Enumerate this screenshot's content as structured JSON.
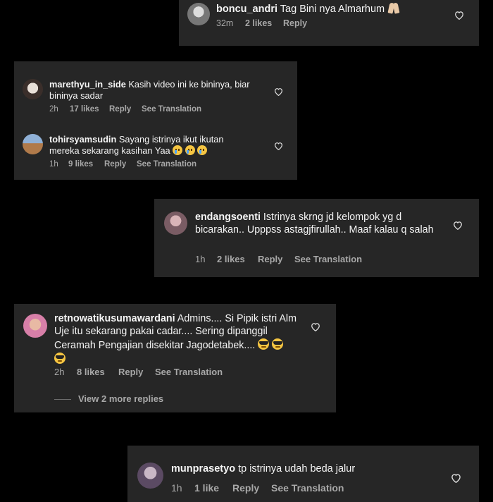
{
  "comments": [
    {
      "username": "boncu_andri",
      "text": "Tag Bini nya Almarhum",
      "emoji_trailing": "folded-hands",
      "time": "32m",
      "likes": "2 likes",
      "reply": "Reply"
    },
    {
      "username": "marethyu_in_side",
      "text": "Kasih video ini ke bininya, biar bininya sadar",
      "time": "2h",
      "likes": "17 likes",
      "reply": "Reply",
      "translate": "See Translation"
    },
    {
      "username": "tohirsyamsudin",
      "text": "Sayang istrinya ikut ikutan mereka sekarang kasihan Yaa",
      "emoji_trailing": "crying-face x3",
      "time": "1h",
      "likes": "9 likes",
      "reply": "Reply",
      "translate": "See Translation"
    },
    {
      "username": "endangsoenti",
      "text": "Istrinya skrng jd kelompok yg d bicarakan.. Upppss astagjfirullah.. Maaf kalau q salah",
      "time": "1h",
      "likes": "2 likes",
      "reply": "Reply",
      "translate": "See Translation"
    },
    {
      "username": "retnowatikusumawardani",
      "text": "Admins.... Si Pipik istri Alm Uje itu sekarang pakai cadar.... Sering dipanggil Ceramah Pengajian disekitar Jagodetabek....",
      "emoji_trailing": "sunglasses-face x3",
      "time": "2h",
      "likes": "8 likes",
      "reply": "Reply",
      "translate": "See Translation",
      "more_replies": "View 2 more replies"
    },
    {
      "username": "munprasetyo",
      "text": "tp istrinya udah beda jalur",
      "time": "1h",
      "likes": "1 like",
      "reply": "Reply",
      "translate": "See Translation"
    }
  ],
  "icons": {
    "like": "heart-outline-icon"
  },
  "colors": {
    "background": "#000000",
    "card": "#262626",
    "text": "#f5f5f5",
    "meta": "#a8a8a8"
  }
}
